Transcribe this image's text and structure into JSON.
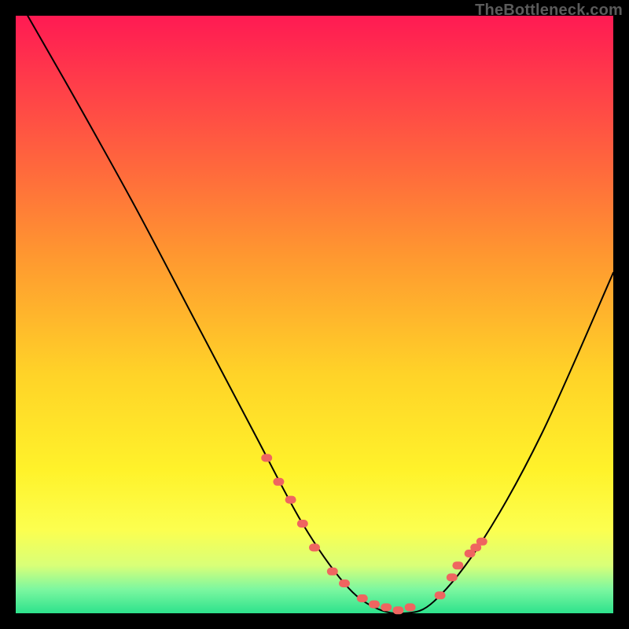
{
  "watermark": "TheBottleneck.com",
  "colors": {
    "frame": "#000000",
    "curve": "#000000",
    "marker": "#ef6560"
  },
  "chart_data": {
    "type": "line",
    "title": "",
    "xlabel": "",
    "ylabel": "",
    "xlim": [
      0,
      100
    ],
    "ylim": [
      0,
      100
    ],
    "grid": false,
    "legend": false,
    "series": [
      {
        "name": "curve",
        "x": [
          2,
          10,
          20,
          30,
          40,
          48,
          55,
          60,
          65,
          70,
          78,
          88,
          100
        ],
        "values": [
          100,
          86,
          68,
          49,
          30,
          15,
          5,
          1,
          0,
          2,
          12,
          30,
          57
        ]
      }
    ],
    "markers": {
      "name": "highlighted-points",
      "x": [
        42,
        44,
        46,
        48,
        50,
        53,
        55,
        58,
        60,
        62,
        64,
        66,
        71,
        73,
        74,
        76,
        77,
        78
      ],
      "values": [
        26,
        22,
        19,
        15,
        11,
        7,
        5,
        2.5,
        1.5,
        1,
        0.5,
        1,
        3,
        6,
        8,
        10,
        11,
        12
      ]
    }
  }
}
